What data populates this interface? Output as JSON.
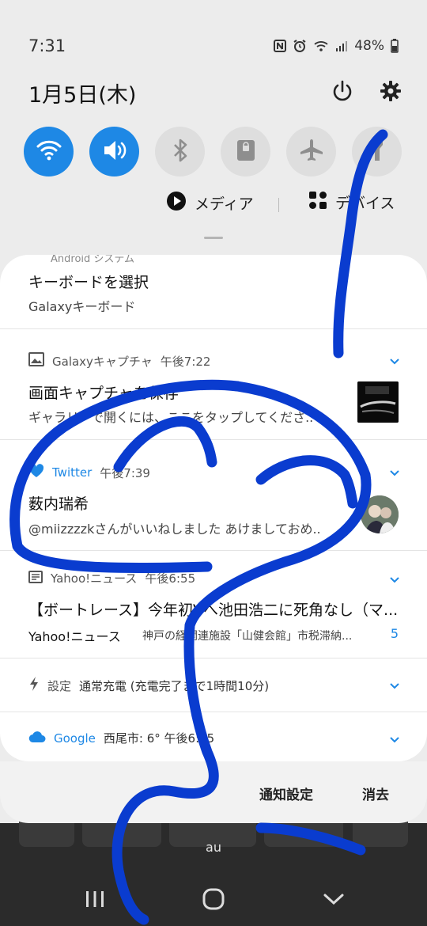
{
  "status_bar": {
    "time": "7:31",
    "battery": "48%",
    "icons": [
      "nfc-icon",
      "alarm-icon",
      "wifi-icon",
      "signal-icon",
      "battery-icon"
    ]
  },
  "header": {
    "date": "1月5日(木)",
    "icons": [
      "power-icon",
      "settings-icon"
    ]
  },
  "quick_toggles": [
    {
      "name": "wifi",
      "state": "on"
    },
    {
      "name": "sound",
      "state": "on"
    },
    {
      "name": "bluetooth",
      "state": "off"
    },
    {
      "name": "rotation-lock",
      "state": "off"
    },
    {
      "name": "airplane-mode",
      "state": "off"
    },
    {
      "name": "flashlight",
      "state": "off"
    }
  ],
  "media_bar": {
    "media_label": "メディア",
    "device_label": "デバイス"
  },
  "notifications": [
    {
      "peek": "Android システム",
      "title": "キーボードを選択",
      "text": "Galaxyキーボード"
    },
    {
      "app": "Galaxyキャプチャ",
      "time": "午後7:22",
      "title": "画面キャプチャを保存",
      "text": "ギャラリーで開くには、ここをタップしてくださ.."
    },
    {
      "app": "Twitter",
      "time": "午後7:39",
      "title": "薮内瑞希",
      "text": "@miizzzzkさんがいいねしました あけましておめ.."
    },
    {
      "app": "Yahoo!ニュース",
      "time": "午後6:55",
      "title": "【ボートレース】今年初Vへ池田浩二に死角なし（マ...",
      "text_source": "Yahoo!ニュース",
      "text": "神戸の経関連施設「山健会館」市税滞納...",
      "count": "5"
    },
    {
      "app": "設定",
      "text": "通常充電 (充電完了まで1時間10分)"
    },
    {
      "app": "Google",
      "text": "西尾市: 6°  午後6:55"
    }
  ],
  "actions": {
    "notification_settings": "通知設定",
    "clear": "消去"
  },
  "keyboard": {
    "carrier": "au"
  },
  "colors": {
    "accent": "#1e88e5",
    "scribble": "#0a3ccf",
    "toggle_off": "#dedede"
  }
}
